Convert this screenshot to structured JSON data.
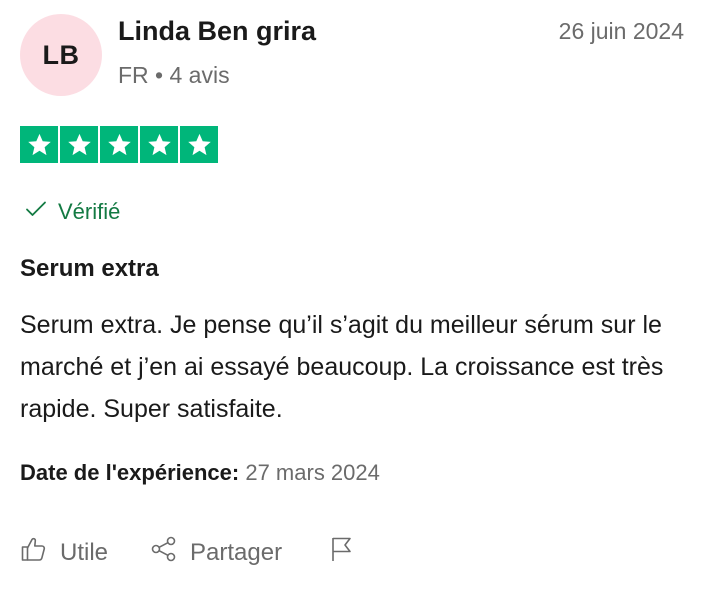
{
  "reviewer": {
    "initials": "LB",
    "name": "Linda Ben grira",
    "meta": "FR • 4 avis",
    "avatar_color": "#fcdde3"
  },
  "review": {
    "date": "26 juin 2024",
    "rating": 5,
    "rating_max": 5,
    "star_color": "#00b67a",
    "verified_label": "Vérifié",
    "title": "Serum extra",
    "body": "Serum extra. Je pense qu’il s’agit du meilleur sérum sur le marché et j’en ai essayé beaucoup. La croissance est très rapide. Super satisfaite.",
    "experience_label": "Date de l'expérience:",
    "experience_date": "27 mars 2024"
  },
  "actions": {
    "useful_label": "Utile",
    "share_label": "Partager"
  },
  "icons": [
    "star-icon",
    "checkmark-icon",
    "thumbs-up-icon",
    "share-icon",
    "flag-icon"
  ]
}
